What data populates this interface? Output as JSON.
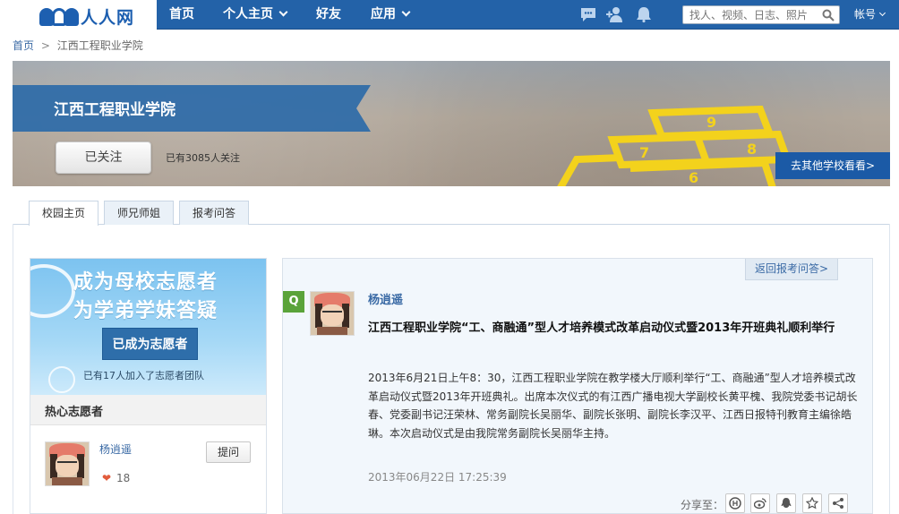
{
  "logo": {
    "text": "人人网"
  },
  "nav": {
    "home": "首页",
    "profile": "个人主页",
    "friends": "好友",
    "apps": "应用",
    "search_placeholder": "找人、视频、日志、照片",
    "account": "帐号"
  },
  "breadcrumb": {
    "home": "首页",
    "sep": ">",
    "current": "江西工程职业学院"
  },
  "banner": {
    "school_name": "江西工程职业学院",
    "follow_button": "已关注",
    "follower_count": "已有3085人关注",
    "other_school": "去其他学校看看>"
  },
  "tabs": [
    "校园主页",
    "师兄师姐",
    "报考问答"
  ],
  "volunteer": {
    "line1": "成为母校志愿者",
    "line2": "为学弟学妹答疑",
    "join_button": "已成为志愿者",
    "join_count": "已有17人加入了志愿者团队",
    "section_title": "热心志愿者",
    "item": {
      "name": "杨逍遥",
      "likes": "18",
      "ask_button": "提问"
    }
  },
  "qa": {
    "back_link": "返回报考问答>",
    "badge": "Q",
    "asker": "杨逍遥",
    "title": "江西工程职业学院“工、商融通”型人才培养模式改革启动仪式暨2013年开班典礼顺利举行",
    "body": "2013年6月21日上午8：30，江西工程职业学院在教学楼大厅顺利举行“工、商融通”型人才培养模式改革启动仪式暨2013年开班典礼。出席本次仪式的有江西广播电视大学副校长黄平槐、我院党委书记胡长春、党委副书记汪荣林、常务副院长吴丽华、副院长张明、副院长李汉平、江西日报特刊教育主编徐皓琳。本次启动仪式是由我院常务副院长吴丽华主持。",
    "time": "2013年06月22日  17:25:39",
    "share_label": "分享至："
  },
  "colors": {
    "nav_bg": "#2362a8",
    "accent": "#3a6aa5",
    "badge_green": "#5aa33a"
  }
}
